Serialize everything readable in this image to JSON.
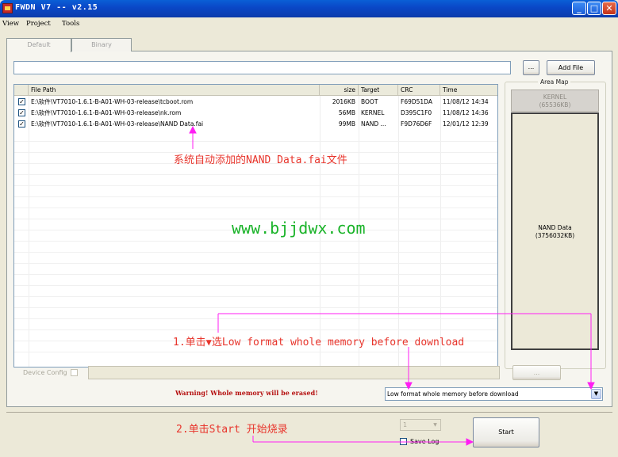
{
  "window": {
    "title": "FWDN V7 -- v2.15"
  },
  "menu": {
    "items": [
      "View",
      "Project",
      "Tools"
    ]
  },
  "tabs": [
    "Default",
    "Binary"
  ],
  "toolbar": {
    "browse_label": "...",
    "add_file_label": "Add File",
    "path_value": ""
  },
  "file_list": {
    "columns": [
      "File Path",
      "size",
      "Target",
      "CRC",
      "Time"
    ],
    "rows": [
      {
        "checked": true,
        "path": "E:\\软件\\VT7010-1.6.1-B-A01-WH-03-release\\tcboot.rom",
        "size": "2016KB",
        "target": "BOOT",
        "crc": "F69D51DA",
        "time": "11/08/12 14:34"
      },
      {
        "checked": true,
        "path": "E:\\软件\\VT7010-1.6.1-B-A01-WH-03-release\\nk.rom",
        "size": "56MB",
        "target": "KERNEL",
        "crc": "D395C1F0",
        "time": "11/08/12 14:36"
      },
      {
        "checked": true,
        "path": "E:\\软件\\VT7010-1.6.1-B-A01-WH-03-release\\NAND Data.fai",
        "size": "99MB",
        "target": "NAND ...",
        "crc": "F9D76D6F",
        "time": "12/01/12 12:39"
      }
    ]
  },
  "area_map": {
    "title": "Area Map",
    "kernel": {
      "name": "KERNEL",
      "size": "(65536KB)"
    },
    "nand": {
      "name": "NAND Data",
      "size": "(3756032KB)"
    }
  },
  "device_config": {
    "label": "Device Config",
    "browse_label": "..."
  },
  "warning": "Warning! Whole memory will be erased!",
  "format_option": "Low format whole memory before download",
  "start": {
    "count": "1",
    "save_log_label": "Save Log",
    "start_label": "Start"
  },
  "annotations": {
    "note1": "系统自动添加的NAND Data.fai文件",
    "watermark": "www.bjjdwx.com",
    "step1_prefix": "1.单击",
    "step1_suffix": "选Low format whole memory before download",
    "step2": "2.单击Start 开始烧录"
  },
  "colors": {
    "annotation": "#e8352c",
    "arrow": "#ff1ef3",
    "watermark": "#19b328",
    "warning": "#b51010"
  }
}
